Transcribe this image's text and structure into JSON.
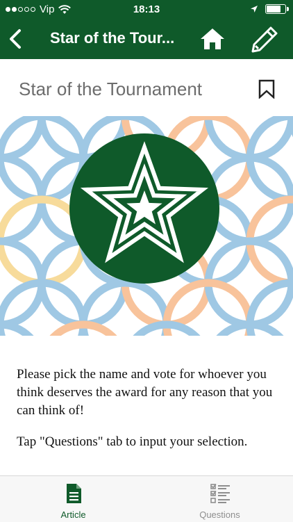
{
  "status_bar": {
    "carrier": "Vip",
    "time": "18:13",
    "battery_level": 0.85
  },
  "nav": {
    "title": "Star of the Tour...",
    "icons": [
      "back-chevron-icon",
      "home-icon",
      "pencil-icon"
    ]
  },
  "page": {
    "title": "Star of the Tournament",
    "bookmark_icon": "bookmark-icon"
  },
  "colors": {
    "brand_green": "#0f5a2a",
    "pattern_blue": "#8fbfe0",
    "pattern_orange": "#f7b98a",
    "pattern_yellow": "#f6d58a"
  },
  "article": {
    "paragraphs": [
      "Please pick the name and vote for whoever you think deserves the award for any reason that you can think of!",
      "Tap \"Questions\" tab to input your selection."
    ]
  },
  "tabs": [
    {
      "label": "Article",
      "icon": "document-icon",
      "active": true
    },
    {
      "label": "Questions",
      "icon": "checklist-icon",
      "active": false
    }
  ]
}
